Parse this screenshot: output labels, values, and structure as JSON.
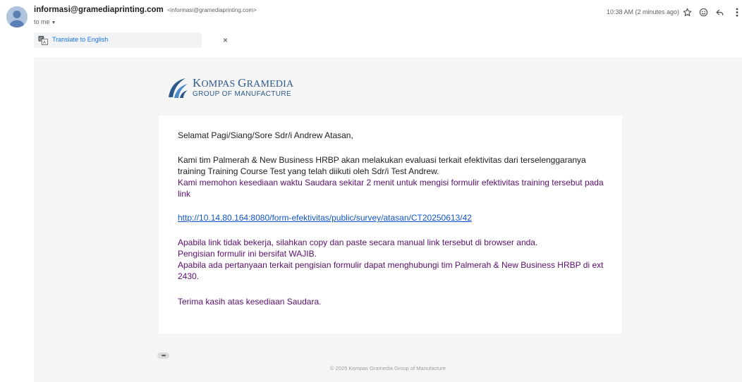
{
  "header": {
    "sender_name": "informasi@gramediaprinting.com",
    "sender_email": "<informasi@gramediaprinting.com>",
    "recipient": "to me",
    "timestamp": "10:38 AM (2 minutes ago)",
    "icons": [
      "star-icon",
      "emoji-icon",
      "reply-icon",
      "more-vert-icon"
    ]
  },
  "translate": {
    "link": "Translate to English",
    "close": "×"
  },
  "logo": {
    "line1_k": "K",
    "line1_rest1": "OMPAS ",
    "line1_g": "G",
    "line1_rest2": "RAMEDIA",
    "line2": "GROUP OF MANUFACTURE"
  },
  "email": {
    "greeting": "Selamat Pagi/Siang/Sore Sdr/i Andrew Atasan,",
    "para1": "Kami tim Palmerah & New Business HRBP akan melakukan evaluasi terkait efektivitas dari terselenggaranya training Training Course Test yang telah diikuti oleh Sdr/i Test Andrew.",
    "para2": "Kami memohon kesediaan waktu Saudara sekitar 2 menit untuk mengisi formulir efektivitas training tersebut pada link",
    "link": "http://10.14.80.164:8080/form-efektivitas/public/survey/atasan/CT20250613/42",
    "para3": "Apabila link tidak bekerja, silahkan copy dan paste secara manual link tersebut di browser anda.",
    "para4": "Pengisian formulir ini bersifat WAJIB.",
    "para5": "Apabila ada pertanyaan terkait pengisian formulir dapat menghubungi tim Palmerah & New Business HRBP di ext 2430.",
    "para6": "Terima kasih atas kesediaan Saudara."
  },
  "footer": "© 2025 Kompas Gramedia Group of Manufacture",
  "colors": {
    "purple_text": "#5b0f6e",
    "link_blue": "#1155cc",
    "logo_blue": "#2b5a8a",
    "frame_bg": "#f5f5f5"
  }
}
